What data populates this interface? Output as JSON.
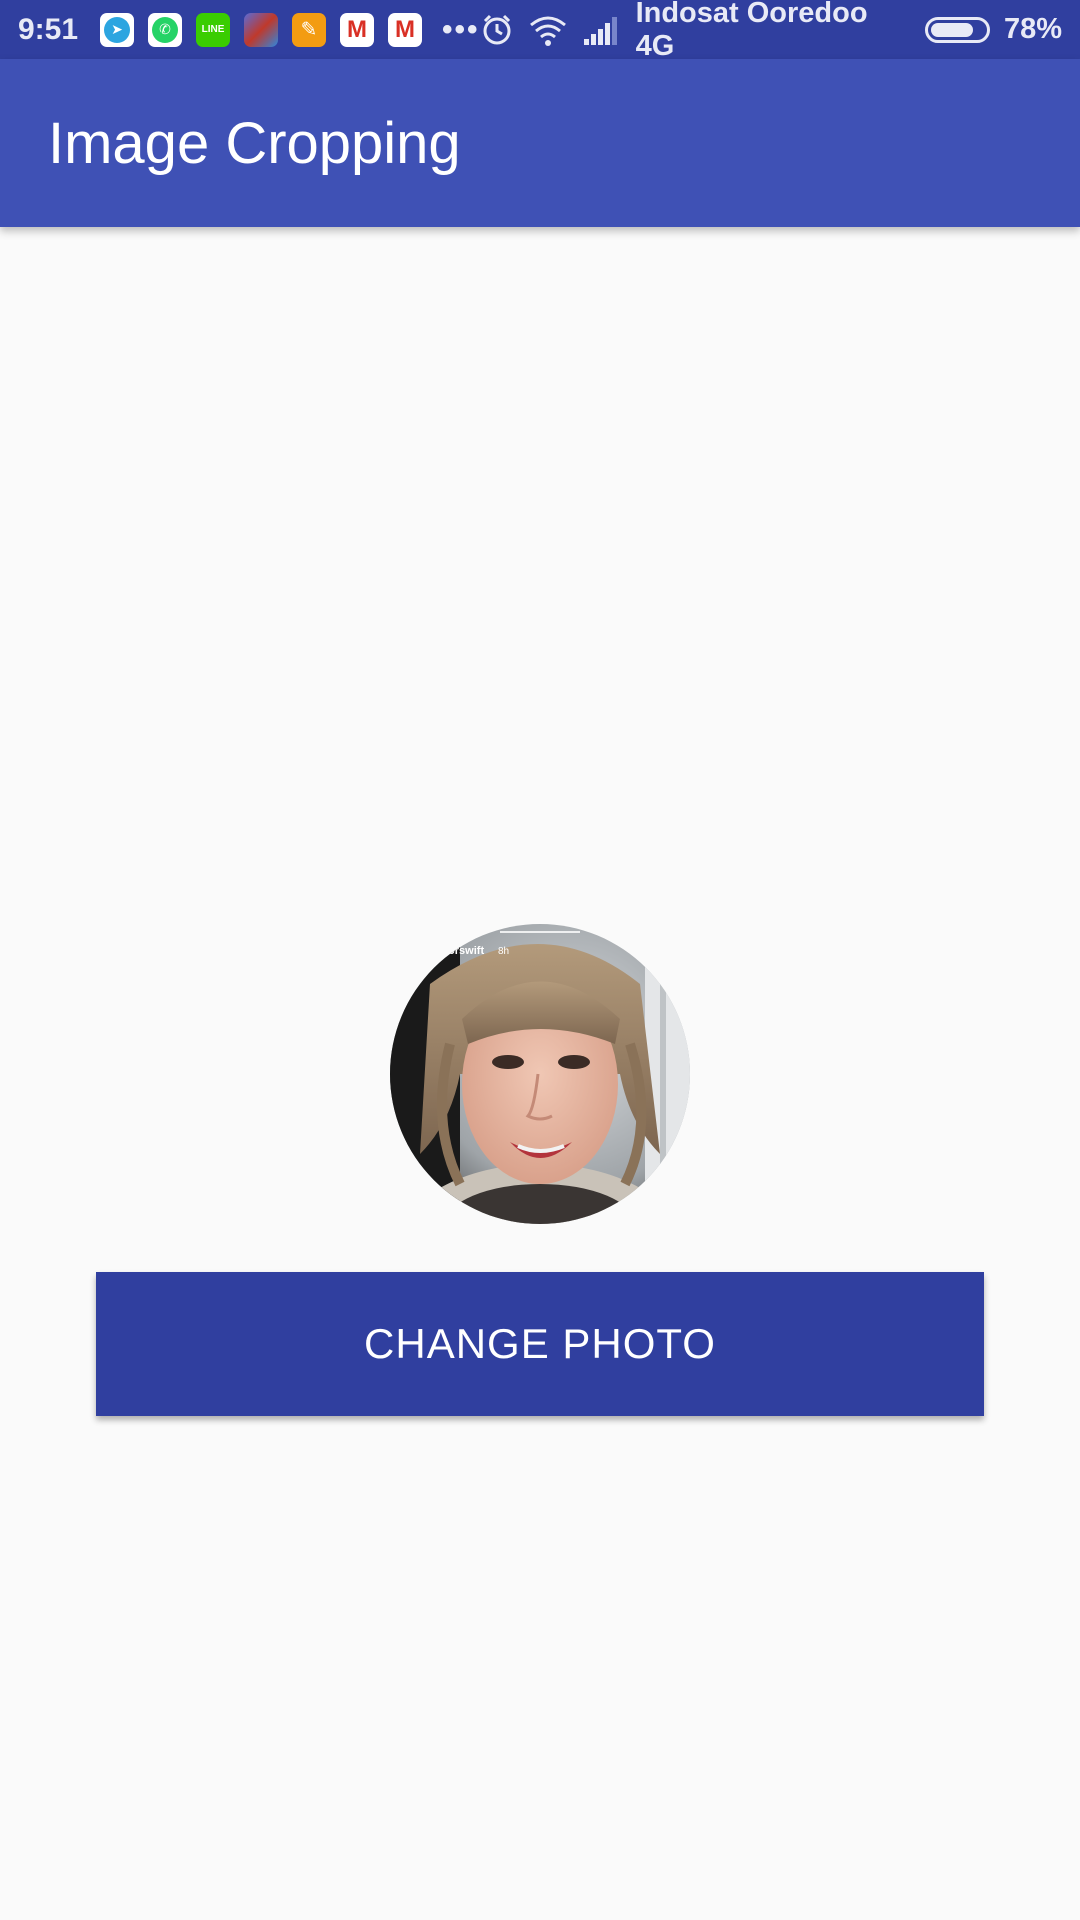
{
  "status_bar": {
    "time": "9:51",
    "notifications": [
      {
        "name": "telegram-icon",
        "glyph": "➤"
      },
      {
        "name": "whatsapp-icon",
        "glyph": "✆"
      },
      {
        "name": "line-icon",
        "glyph": "LINE"
      },
      {
        "name": "game-app-icon",
        "glyph": ""
      },
      {
        "name": "orange-app-icon",
        "glyph": "✎"
      },
      {
        "name": "gmail-icon",
        "glyph": "M"
      },
      {
        "name": "gmail-icon",
        "glyph": "M"
      }
    ],
    "more": "•••",
    "carrier": "Indosat Ooredoo 4G",
    "battery_percent": "78%",
    "battery_level": 0.78
  },
  "app_bar": {
    "title": "Image Cropping"
  },
  "profile": {
    "photo_overlay_text": "lorswift",
    "photo_overlay_time": "8h"
  },
  "actions": {
    "change_photo_label": "CHANGE PHOTO"
  },
  "colors": {
    "status_bar": "#303f9f",
    "app_bar": "#3f51b5",
    "button": "#303f9f",
    "background": "#fafafa"
  }
}
